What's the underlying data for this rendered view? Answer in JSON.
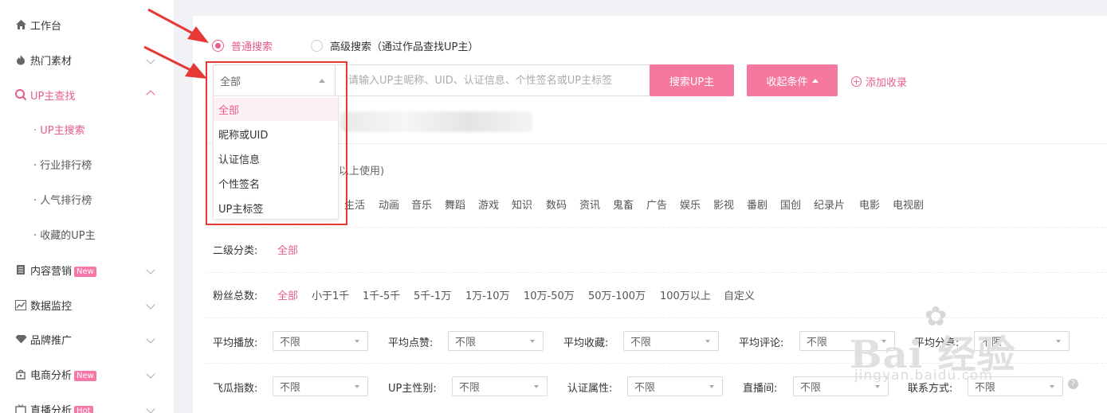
{
  "sidebar": {
    "items": [
      {
        "label": "工作台",
        "icon": "home-icon"
      },
      {
        "label": "热门素材",
        "icon": "fire-icon"
      },
      {
        "label": "UP主查找",
        "icon": "search-icon"
      },
      {
        "label": "内容营销",
        "icon": "document-icon",
        "badge": "New"
      },
      {
        "label": "数据监控",
        "icon": "chart-icon"
      },
      {
        "label": "品牌推广",
        "icon": "diamond-icon"
      },
      {
        "label": "电商分析",
        "icon": "shop-icon",
        "badge": "New"
      },
      {
        "label": "直播分析",
        "icon": "tv-icon",
        "badge": "Hot"
      }
    ],
    "subitems": [
      "· UP主搜索",
      "· 行业排行榜",
      "· 人气排行榜",
      "· 收藏的UP主"
    ]
  },
  "search": {
    "mode_normal": "普通搜索",
    "mode_advanced": "高级搜索（通过作品查找UP主）",
    "scope_value": "全部",
    "placeholder": "请输入UP主昵称、UID、认证信息、个性签名或UP主标签",
    "search_button": "搜索UP主",
    "collapse_button": "收起条件",
    "add_collection": "添加收录"
  },
  "dropdown_options": [
    "全部",
    "昵称或UID",
    "认证信息",
    "个性签名",
    "UP主标签"
  ],
  "partial_text": "以上使用)",
  "categories": [
    "生活",
    "动画",
    "音乐",
    "舞蹈",
    "游戏",
    "知识",
    "数码",
    "资讯",
    "鬼畜",
    "广告",
    "娱乐",
    "影视",
    "番剧",
    "国创",
    "纪录片",
    "电影",
    "电视剧"
  ],
  "secondary": {
    "label": "二级分类:",
    "value": "全部"
  },
  "fans": {
    "label": "粉丝总数:",
    "options": [
      "全部",
      "小于1千",
      "1千-5千",
      "5千-1万",
      "1万-10万",
      "10万-50万",
      "50万-100万",
      "100万以上",
      "自定义"
    ]
  },
  "filters_row1": [
    {
      "label": "平均播放:",
      "value": "不限"
    },
    {
      "label": "平均点赞:",
      "value": "不限"
    },
    {
      "label": "平均收藏:",
      "value": "不限"
    },
    {
      "label": "平均评论:",
      "value": "不限"
    },
    {
      "label": "平均分享:",
      "value": "不限"
    }
  ],
  "filters_row2": [
    {
      "label": "飞瓜指数:",
      "value": "不限"
    },
    {
      "label": "UP主性别:",
      "value": "不限"
    },
    {
      "label": "认证属性:",
      "value": "不限"
    },
    {
      "label": "直播间:",
      "value": "不限"
    },
    {
      "label": "联系方式:",
      "value": "不限"
    }
  ],
  "help": "?",
  "watermark": {
    "brand": "Bai 经验",
    "url": "jingyan.baidu.com"
  },
  "colors": {
    "accent": "#e85d8a",
    "button": "#f5789f",
    "annotation": "#e53935"
  }
}
